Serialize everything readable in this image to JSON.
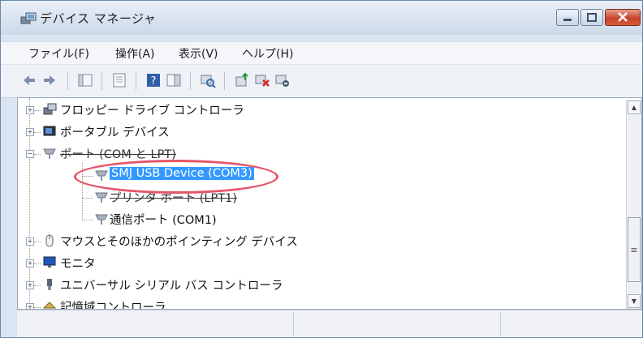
{
  "window": {
    "title": "デバイス マネージャ"
  },
  "menu": [
    "ファイル(F)",
    "操作(A)",
    "表示(V)",
    "ヘルプ(H)"
  ],
  "tree": {
    "items": [
      {
        "label": "フロッピー ドライブ コントローラ",
        "icon": "floppy-controller-icon"
      },
      {
        "label": "ポータブル デバイス",
        "icon": "portable-device-icon"
      },
      {
        "label": "ポート (COM と LPT)",
        "icon": "port-icon"
      },
      {
        "label": "SMJ USB Device (COM3)",
        "icon": "port-icon"
      },
      {
        "label": "プリンタ ポート (LPT1)",
        "icon": "port-icon"
      },
      {
        "label": "通信ポート (COM1)",
        "icon": "port-icon"
      },
      {
        "label": "マウスとそのほかのポインティング デバイス",
        "icon": "mouse-icon"
      },
      {
        "label": "モニタ",
        "icon": "monitor-icon"
      },
      {
        "label": "ユニバーサル シリアル バス コントローラ",
        "icon": "usb-icon"
      },
      {
        "label": "記憶域コントローラ",
        "icon": "storage-controller-icon"
      }
    ]
  }
}
